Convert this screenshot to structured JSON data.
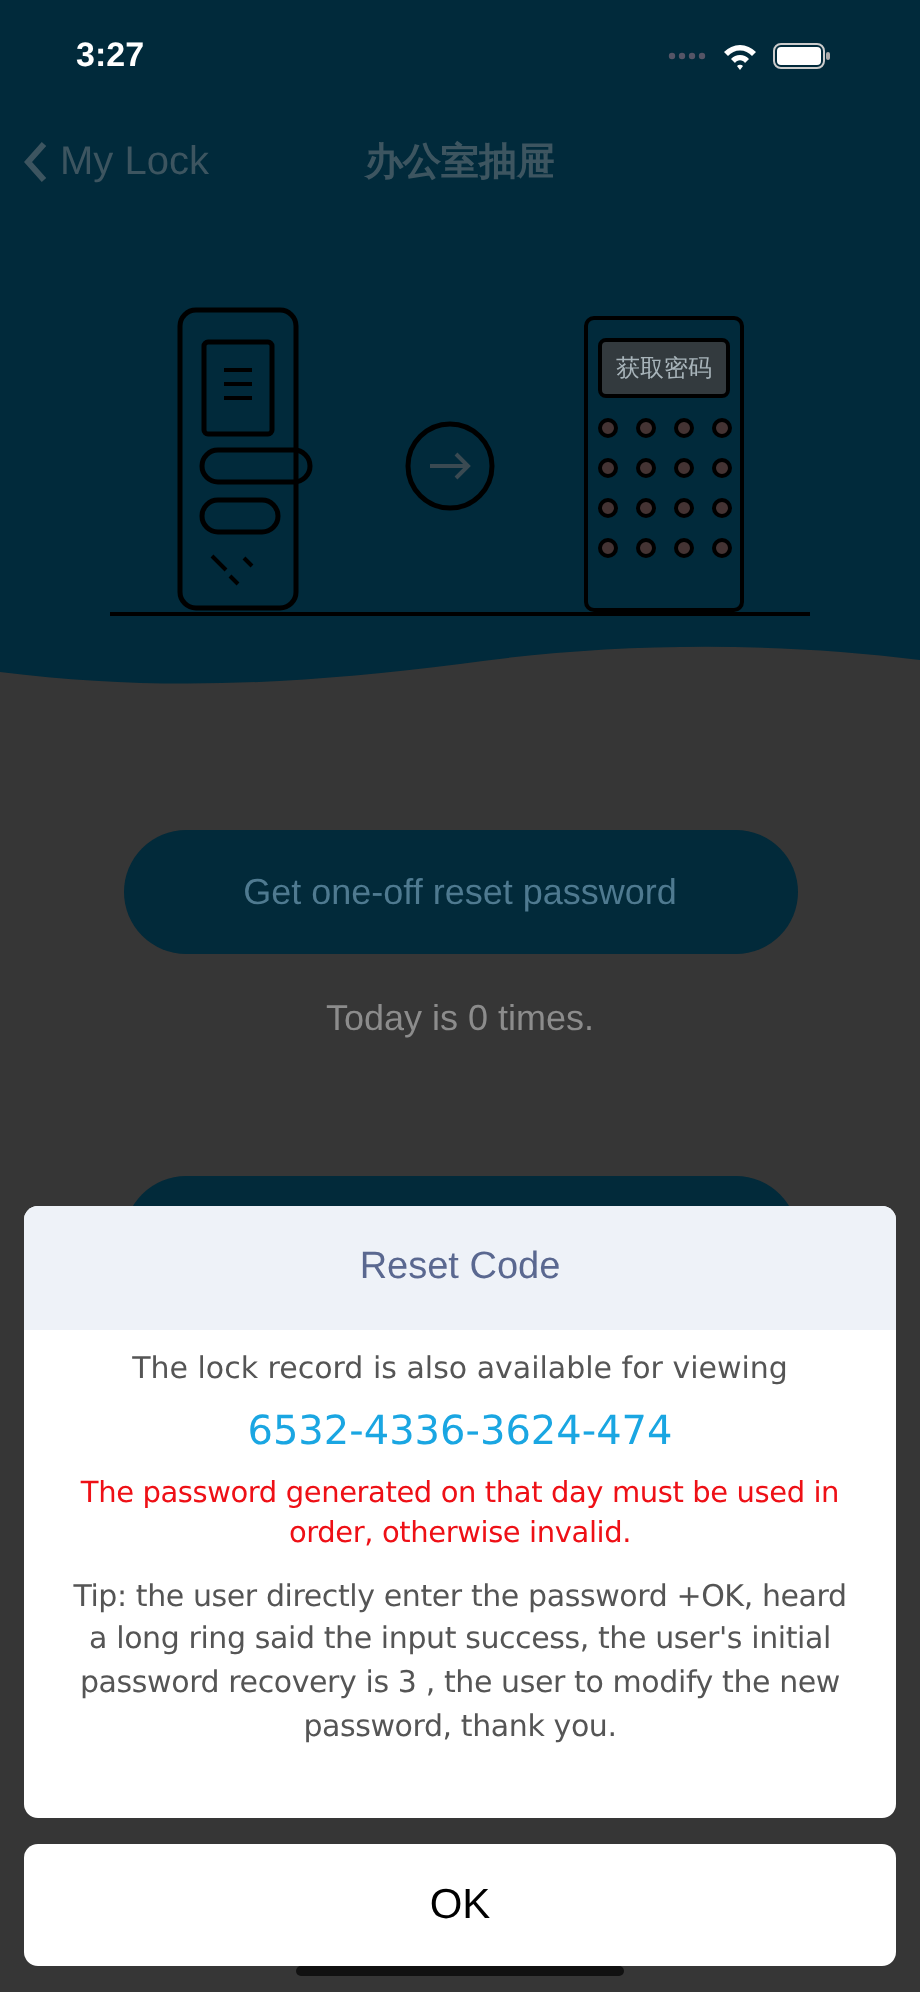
{
  "status_bar": {
    "time": "3:27"
  },
  "nav": {
    "back": "My Lock",
    "title": "办公室抽屉"
  },
  "illustration": {
    "keypad_screen": "获取密码"
  },
  "reset_button": {
    "label": "Get one-off reset password"
  },
  "today_count": "Today is 0 times.",
  "dialog": {
    "title": "Reset Code",
    "message": "The lock record is also available for viewing",
    "code": "6532-4336-3624-474",
    "warning": "The password generated on that day must be used in order, otherwise invalid.",
    "tip": "Tip: the user directly enter the password +OK, heard a long ring said the input success, the user's initial password recovery is 3 , the user to modify the new password, thank you."
  },
  "ok_button": "OK"
}
